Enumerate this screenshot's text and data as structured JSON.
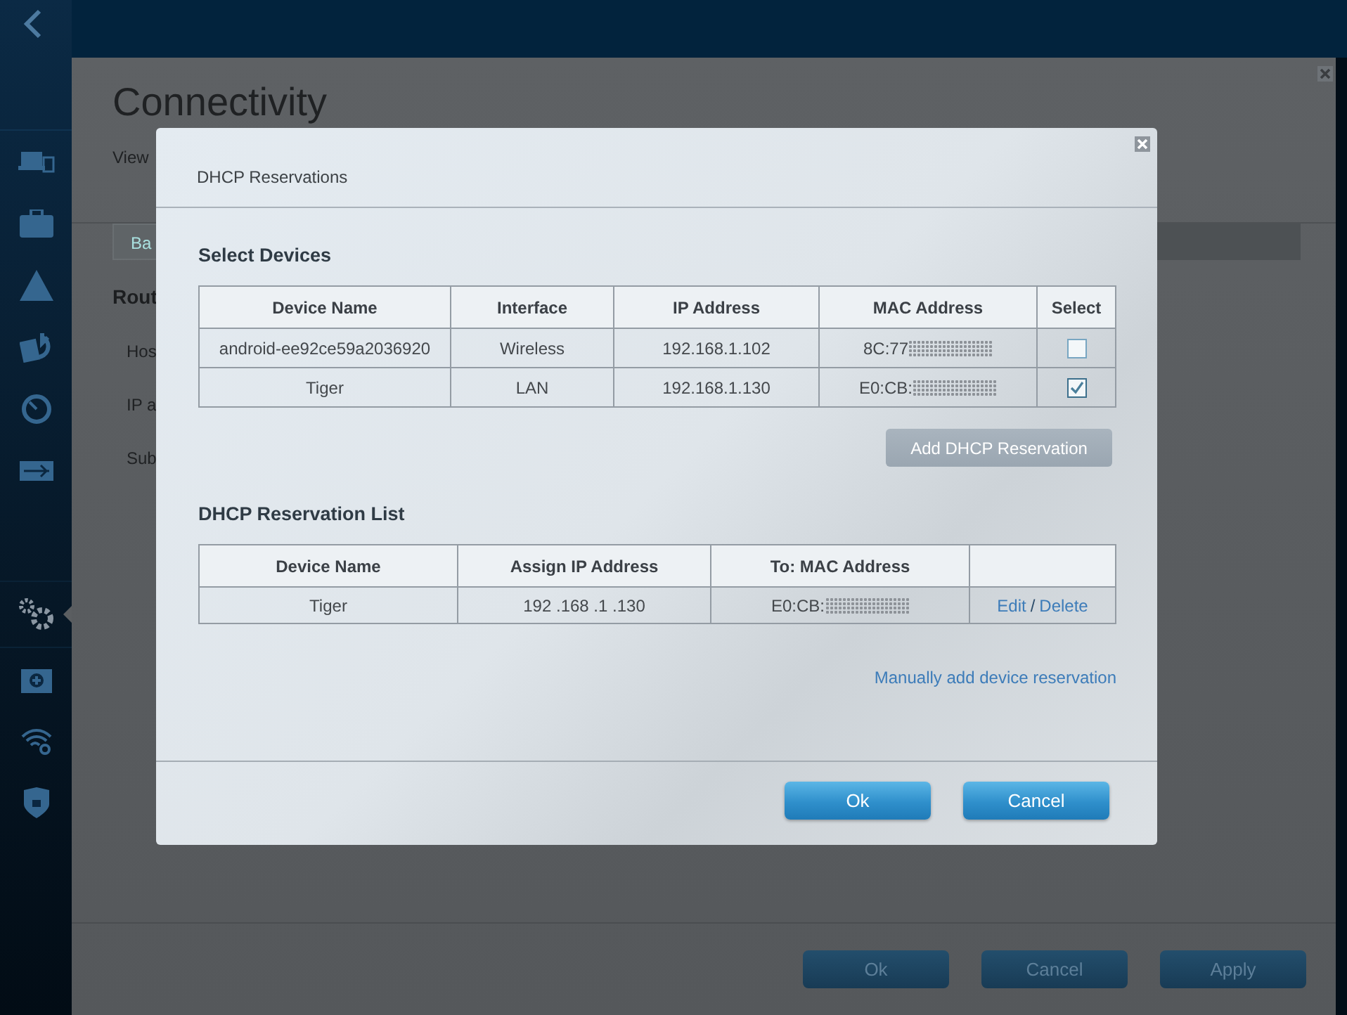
{
  "sidebar": {
    "items": [
      {
        "kind": "devices",
        "selected": false
      },
      {
        "kind": "toolbox",
        "selected": false
      },
      {
        "kind": "warning",
        "selected": false
      },
      {
        "kind": "arrows",
        "selected": false
      },
      {
        "kind": "clock",
        "selected": false
      },
      {
        "kind": "usb",
        "selected": false
      },
      {
        "kind": "gears",
        "selected": true
      },
      {
        "kind": "medkit",
        "selected": false
      },
      {
        "kind": "wifi",
        "selected": false
      },
      {
        "kind": "shield",
        "selected": false
      }
    ]
  },
  "page": {
    "title": "Connectivity",
    "subtitle": "View",
    "tabs": [
      {
        "label": "Ba"
      }
    ],
    "section": "Rout",
    "fields": [
      "Hos",
      "IP a",
      "Sub"
    ],
    "buttons": [
      "Ok",
      "Cancel",
      "Apply"
    ]
  },
  "dialog": {
    "title": "DHCP Reservations",
    "devices": {
      "heading": "Select Devices",
      "columns": [
        "Device Name",
        "Interface",
        "IP Address",
        "MAC Address",
        "Select"
      ],
      "rows": [
        {
          "device_name": "android-ee92ce59a2036920",
          "interface": "Wireless",
          "ip_address": "192.168.1.102",
          "mac_address": "8C:77",
          "checked": false
        },
        {
          "device_name": "Tiger",
          "interface": "LAN",
          "ip_address": "192.168.1.130",
          "mac_address": "E0:CB:",
          "checked": true
        }
      ]
    },
    "add_button": {
      "label": "Add DHCP Reservation",
      "disabled": true
    },
    "reservations": {
      "heading": "DHCP Reservation List",
      "columns": [
        "Device Name",
        "Assign IP Address",
        "To: MAC Address"
      ],
      "rows": [
        {
          "device_name": "Tiger",
          "ip_address": "192 .168 .1 .130",
          "mac_address": "E0:CB:",
          "edit": "Edit",
          "separator": "/",
          "delete": "Delete"
        }
      ]
    },
    "manual_link": "Manually add device reservation",
    "buttons": [
      "Ok",
      "Cancel"
    ]
  }
}
